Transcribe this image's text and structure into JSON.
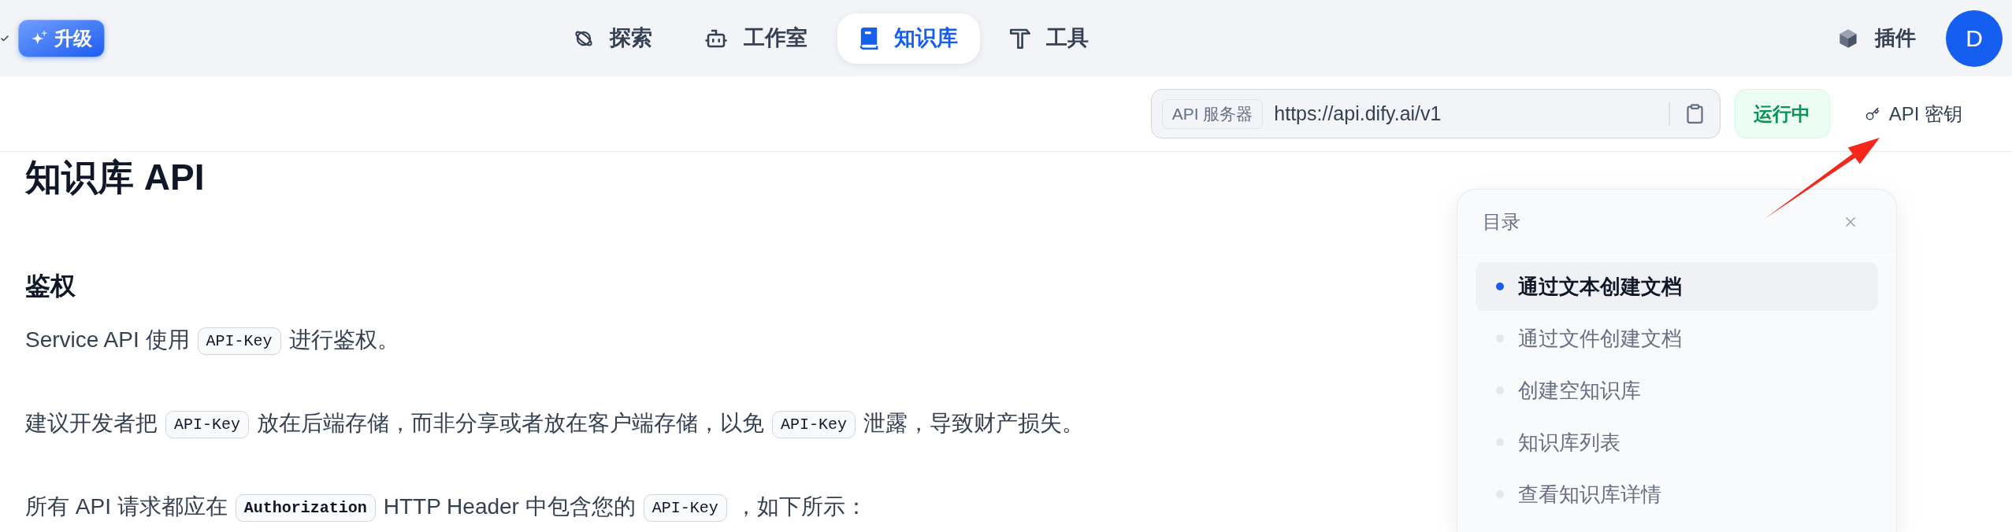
{
  "top_bar": {
    "upgrade_button": "升级",
    "tabs": [
      {
        "label": "探索",
        "selected": false
      },
      {
        "label": "工作室",
        "selected": false
      },
      {
        "label": "知识库",
        "selected": true
      },
      {
        "label": "工具",
        "selected": false
      }
    ],
    "plugins_button": "插件",
    "avatar": "D"
  },
  "api_bar": {
    "server_label": "API 服务器",
    "server_url": "https://api.dify.ai/v1",
    "status": "运行中",
    "api_key_button": "API 密钥"
  },
  "doc": {
    "title": "知识库 API",
    "section_heading": "鉴权",
    "paragraphs": [
      [
        {
          "kind": "text",
          "text": "Service API 使用"
        },
        {
          "kind": "code",
          "text": "API-Key",
          "bold": false
        },
        {
          "kind": "text",
          "text": "进行鉴权。"
        }
      ],
      [
        {
          "kind": "text",
          "text": "建议开发者把"
        },
        {
          "kind": "code",
          "text": "API-Key",
          "bold": false
        },
        {
          "kind": "text",
          "text": "放在后端存储，而非分享或者放在客户端存储，以免"
        },
        {
          "kind": "code",
          "text": "API-Key",
          "bold": false
        },
        {
          "kind": "text",
          "text": "泄露，导致财产损失。"
        }
      ],
      [
        {
          "kind": "text",
          "text": "所有 API 请求都应在"
        },
        {
          "kind": "code",
          "text": "Authorization",
          "bold": true
        },
        {
          "kind": "text",
          "text": "HTTP Header 中包含您的"
        },
        {
          "kind": "code",
          "text": "API-Key",
          "bold": false
        },
        {
          "kind": "text",
          "text": "，如下所示："
        }
      ]
    ]
  },
  "toc": {
    "title": "目录",
    "items": [
      {
        "label": "通过文本创建文档",
        "selected": true
      },
      {
        "label": "通过文件创建文档",
        "selected": false
      },
      {
        "label": "创建空知识库",
        "selected": false
      },
      {
        "label": "知识库列表",
        "selected": false
      },
      {
        "label": "查看知识库详情",
        "selected": false
      }
    ]
  }
}
